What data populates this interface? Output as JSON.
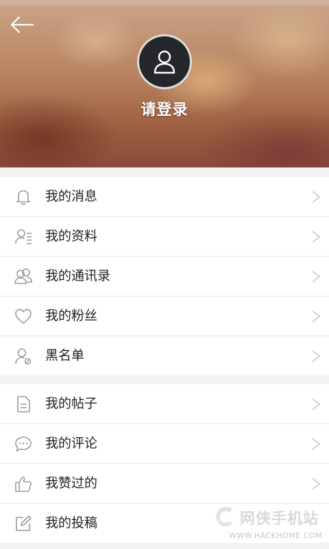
{
  "header": {
    "login_label": "请登录"
  },
  "menu_group_1": [
    {
      "label": "我的消息",
      "icon": "bell-icon"
    },
    {
      "label": "我的资料",
      "icon": "profile-list-icon"
    },
    {
      "label": "我的通讯录",
      "icon": "contacts-icon"
    },
    {
      "label": "我的粉丝",
      "icon": "heart-icon"
    },
    {
      "label": "黑名单",
      "icon": "blocked-user-icon"
    }
  ],
  "menu_group_2": [
    {
      "label": "我的帖子",
      "icon": "document-icon"
    },
    {
      "label": "我的评论",
      "icon": "comment-icon"
    },
    {
      "label": "我赞过的",
      "icon": "thumbs-up-icon"
    },
    {
      "label": "我的投稿",
      "icon": "edit-icon"
    }
  ],
  "watermark": {
    "name": "网侠手机站",
    "url": "WWW.HACKHOME.COM"
  },
  "colors": {
    "icon_stroke": "#9a9a9a",
    "chevron": "#c8c8c8",
    "label": "#222222",
    "background": "#f2f2f2"
  }
}
